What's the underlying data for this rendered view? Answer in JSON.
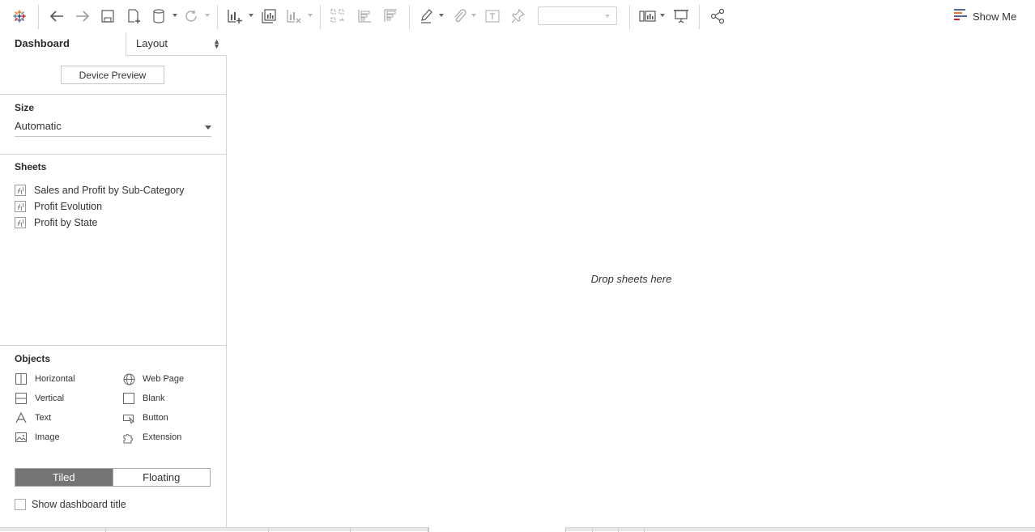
{
  "toolbar": {
    "show_me_label": "Show Me",
    "fit_value": ""
  },
  "sidebar": {
    "tab_dashboard": "Dashboard",
    "tab_layout": "Layout",
    "device_preview_label": "Device Preview",
    "size_title": "Size",
    "size_value": "Automatic",
    "sheets_title": "Sheets",
    "sheets": [
      "Sales and Profit by Sub-Category",
      "Profit Evolution",
      "Profit by State"
    ],
    "objects_title": "Objects",
    "objects": {
      "horizontal": "Horizontal",
      "vertical": "Vertical",
      "text": "Text",
      "image": "Image",
      "web_page": "Web Page",
      "blank": "Blank",
      "button": "Button",
      "extension": "Extension"
    },
    "tiled_label": "Tiled",
    "floating_label": "Floating",
    "show_title_label": "Show dashboard title",
    "show_title_checked": false
  },
  "canvas": {
    "drop_text": "Drop sheets here"
  },
  "colors": {
    "tiled_active": "#747474",
    "border": "#d4d4d4"
  }
}
